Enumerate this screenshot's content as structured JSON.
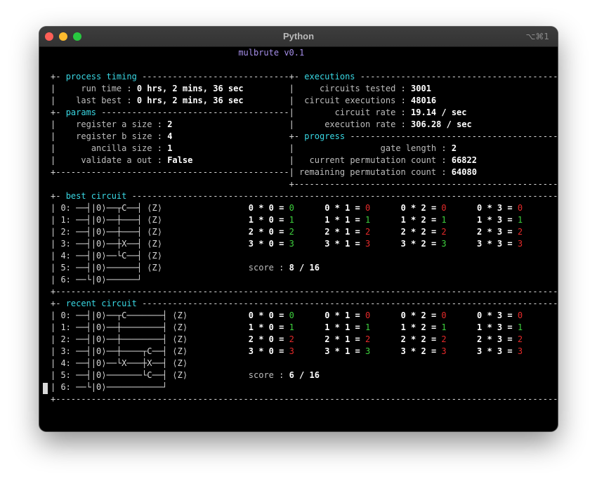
{
  "window": {
    "title": "Python",
    "shortcut": "⌥⌘1"
  },
  "app": {
    "title": "mulbrute v0.1"
  },
  "process_timing": {
    "header": "process timing",
    "run_time_label": "run time",
    "run_time": "0 hrs, 2 mins, 36 sec",
    "last_best_label": "last best",
    "last_best": "0 hrs, 2 mins, 36 sec"
  },
  "params": {
    "header": "params",
    "items": [
      {
        "label": "register a size",
        "value": "2"
      },
      {
        "label": "register b size",
        "value": "4"
      },
      {
        "label": "ancilla size",
        "value": "1"
      },
      {
        "label": "validate a out",
        "value": "False"
      }
    ]
  },
  "executions": {
    "header": "executions",
    "items": [
      {
        "label": "circuits tested",
        "value": "3001"
      },
      {
        "label": "circuit executions",
        "value": "48016"
      },
      {
        "label": "circuit rate",
        "value": "19.14 / sec"
      },
      {
        "label": "execution rate",
        "value": "306.28 / sec"
      }
    ]
  },
  "progress": {
    "header": "progress",
    "items": [
      {
        "label": "gate length",
        "value": "2"
      },
      {
        "label": "current permutation count",
        "value": "66822"
      },
      {
        "label": "remaining permutation count",
        "value": "64080"
      }
    ]
  },
  "best_circuit": {
    "header": "best circuit",
    "diagram": [
      "0: ──┤|0⟩──┬C──┤ ⟨Z⟩",
      "1: ──┤|0⟩──┼───┤ ⟨Z⟩",
      "2: ──┤|0⟩──┼───┤ ⟨Z⟩",
      "3: ──┤|0⟩──┼X──┤ ⟨Z⟩",
      "4: ──┤|0⟩──└C──┤ ⟨Z⟩",
      "5: ──┤|0⟩──────┤ ⟨Z⟩",
      "6: ──└|0⟩──────┘"
    ],
    "results": [
      [
        {
          "expr": "0 * 0 =",
          "value": "0",
          "ok": true
        },
        {
          "expr": "0 * 1 =",
          "value": "0",
          "ok": false
        },
        {
          "expr": "0 * 2 =",
          "value": "0",
          "ok": false
        },
        {
          "expr": "0 * 3 =",
          "value": "0",
          "ok": false
        }
      ],
      [
        {
          "expr": "1 * 0 =",
          "value": "1",
          "ok": true
        },
        {
          "expr": "1 * 1 =",
          "value": "1",
          "ok": true
        },
        {
          "expr": "1 * 2 =",
          "value": "1",
          "ok": true
        },
        {
          "expr": "1 * 3 =",
          "value": "1",
          "ok": true
        }
      ],
      [
        {
          "expr": "2 * 0 =",
          "value": "2",
          "ok": true
        },
        {
          "expr": "2 * 1 =",
          "value": "2",
          "ok": false
        },
        {
          "expr": "2 * 2 =",
          "value": "2",
          "ok": false
        },
        {
          "expr": "2 * 3 =",
          "value": "2",
          "ok": false
        }
      ],
      [
        {
          "expr": "3 * 0 =",
          "value": "3",
          "ok": true
        },
        {
          "expr": "3 * 1 =",
          "value": "3",
          "ok": false
        },
        {
          "expr": "3 * 2 =",
          "value": "3",
          "ok": true
        },
        {
          "expr": "3 * 3 =",
          "value": "3",
          "ok": false
        }
      ]
    ],
    "score_label": "score",
    "score": "8 / 16"
  },
  "recent_circuit": {
    "header": "recent circuit",
    "diagram": [
      "0: ──┤|0⟩──┬C───────┤ ⟨Z⟩",
      "1: ──┤|0⟩──┼────────┤ ⟨Z⟩",
      "2: ──┤|0⟩──┼────────┤ ⟨Z⟩",
      "3: ──┤|0⟩──┼────┬C──┤ ⟨Z⟩",
      "4: ──┤|0⟩──└X───┼X──┤ ⟨Z⟩",
      "5: ──┤|0⟩───────└C──┤ ⟨Z⟩",
      "6: ──└|0⟩───────────┘"
    ],
    "results": [
      [
        {
          "expr": "0 * 0 =",
          "value": "0",
          "ok": true
        },
        {
          "expr": "0 * 1 =",
          "value": "0",
          "ok": false
        },
        {
          "expr": "0 * 2 =",
          "value": "0",
          "ok": false
        },
        {
          "expr": "0 * 3 =",
          "value": "0",
          "ok": false
        }
      ],
      [
        {
          "expr": "1 * 0 =",
          "value": "1",
          "ok": true
        },
        {
          "expr": "1 * 1 =",
          "value": "1",
          "ok": true
        },
        {
          "expr": "1 * 2 =",
          "value": "1",
          "ok": true
        },
        {
          "expr": "1 * 3 =",
          "value": "1",
          "ok": true
        }
      ],
      [
        {
          "expr": "2 * 0 =",
          "value": "2",
          "ok": false
        },
        {
          "expr": "2 * 1 =",
          "value": "2",
          "ok": false
        },
        {
          "expr": "2 * 2 =",
          "value": "2",
          "ok": false
        },
        {
          "expr": "2 * 3 =",
          "value": "2",
          "ok": false
        }
      ],
      [
        {
          "expr": "3 * 0 =",
          "value": "3",
          "ok": false
        },
        {
          "expr": "3 * 1 =",
          "value": "3",
          "ok": true
        },
        {
          "expr": "3 * 2 =",
          "value": "3",
          "ok": false
        },
        {
          "expr": "3 * 3 =",
          "value": "3",
          "ok": false
        }
      ]
    ],
    "score_label": "score",
    "score": "6 / 16"
  },
  "colors": {
    "header": "#39d7e3",
    "app_title": "#a58ee9",
    "correct": "#3ed13e",
    "incorrect": "#e52a2a"
  }
}
